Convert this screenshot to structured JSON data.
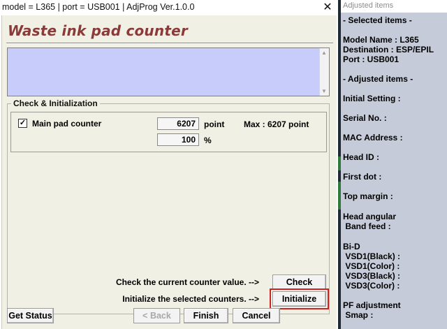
{
  "window": {
    "title": "model = L365 | port = USB001 | AdjProg Ver.1.0.0",
    "close_glyph": "✕"
  },
  "banner": {
    "title": "Waste ink pad counter",
    "color": "#8b3a3a"
  },
  "message_area": {
    "text": "",
    "background": "#c8ccfb",
    "scroll_up_glyph": "▲",
    "scroll_down_glyph": "▼"
  },
  "group": {
    "title": "Check & Initialization",
    "counter": {
      "checked": true,
      "check_glyph": "✓",
      "label": "Main pad counter",
      "value": "6207",
      "unit": "point",
      "max_label": "Max : 6207 point",
      "percent_value": "100",
      "percent_unit": "%"
    },
    "check_hint": "Check the current counter value.  -->",
    "check_label": "Check",
    "init_hint": "Initialize the selected counters.  -->",
    "init_label": "Initialize",
    "highlight_color": "#d02222"
  },
  "footer": {
    "get_status_label": "Get Status",
    "back_label": "< Back",
    "finish_label": "Finish",
    "cancel_label": "Cancel"
  },
  "side_panel": {
    "title": "Adjusted items",
    "selected_header": "- Selected items -",
    "model_name": "Model Name : L365",
    "destination": "Destination : ESP/EPIL",
    "port": "Port : USB001",
    "adjusted_header": "- Adjusted items -",
    "items": [
      "Initial Setting :",
      "Serial No. :",
      "MAC Address :",
      "Head ID :",
      "First dot :",
      "Top margin :",
      "Head angular",
      " Band feed :",
      "Bi-D",
      " VSD1(Black) :",
      " VSD1(Color) :",
      " VSD3(Black) :",
      " VSD3(Color) :",
      "PF adjustment",
      " Smap :"
    ]
  }
}
